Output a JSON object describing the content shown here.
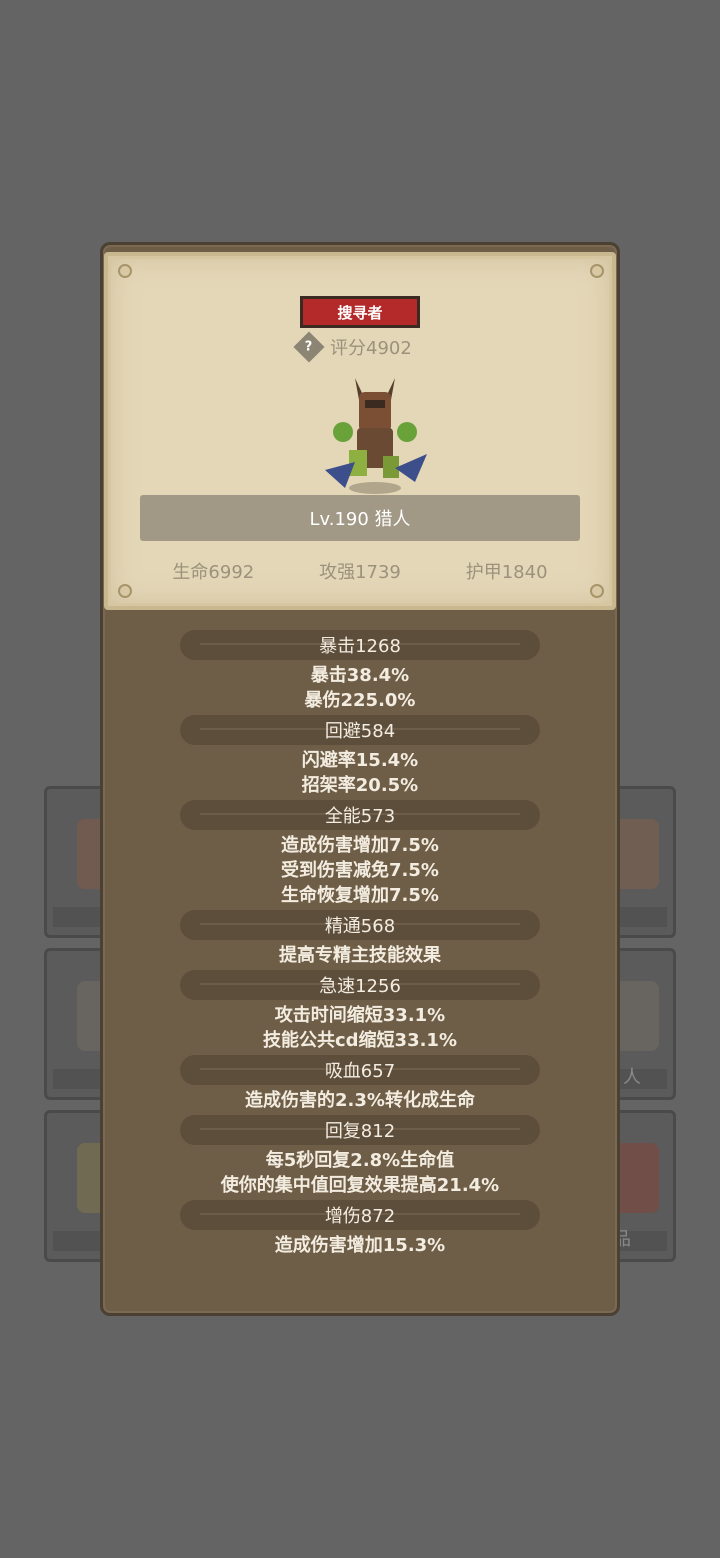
{
  "hero": {
    "class_label": "搜寻者",
    "score_label": "评分4902",
    "name_label": "Lv.190 猎人",
    "help_icon": "?",
    "base_stats": [
      {
        "label": "生命6992"
      },
      {
        "label": "攻强1739"
      },
      {
        "label": "护甲1840"
      }
    ]
  },
  "stats": {
    "crit": {
      "head": "暴击1268",
      "lines": [
        "暴击38.4%",
        "暴伤225.0%"
      ]
    },
    "dodge": {
      "head": "回避584",
      "lines": [
        "闪避率15.4%",
        "招架率20.5%"
      ]
    },
    "versatility": {
      "head": "全能573",
      "lines": [
        "造成伤害增加7.5%",
        "受到伤害减免7.5%",
        "生命恢复增加7.5%"
      ]
    },
    "mastery": {
      "head": "精通568",
      "lines": [
        "提高专精主技能效果"
      ]
    },
    "haste": {
      "head": "急速1256",
      "lines": [
        "攻击时间缩短33.1%",
        "技能公共cd缩短33.1%"
      ]
    },
    "leech": {
      "head": "吸血657",
      "lines": [
        "造成伤害的2.3%转化成生命"
      ]
    },
    "regen": {
      "head": "回复812",
      "lines": [
        "每5秒回复2.8%生命值",
        "使你的集中值回复效果提高21.4%"
      ]
    },
    "damage_bonus": {
      "head": "增伤872",
      "lines": [
        "造成伤害增加15.3%"
      ]
    }
  },
  "background": {
    "card_labels": [
      "人",
      "品"
    ]
  },
  "colors": {
    "badge_red": "#b42a2a",
    "parchment": "#e4d7b8",
    "panel_brown": "#6f5e47"
  }
}
